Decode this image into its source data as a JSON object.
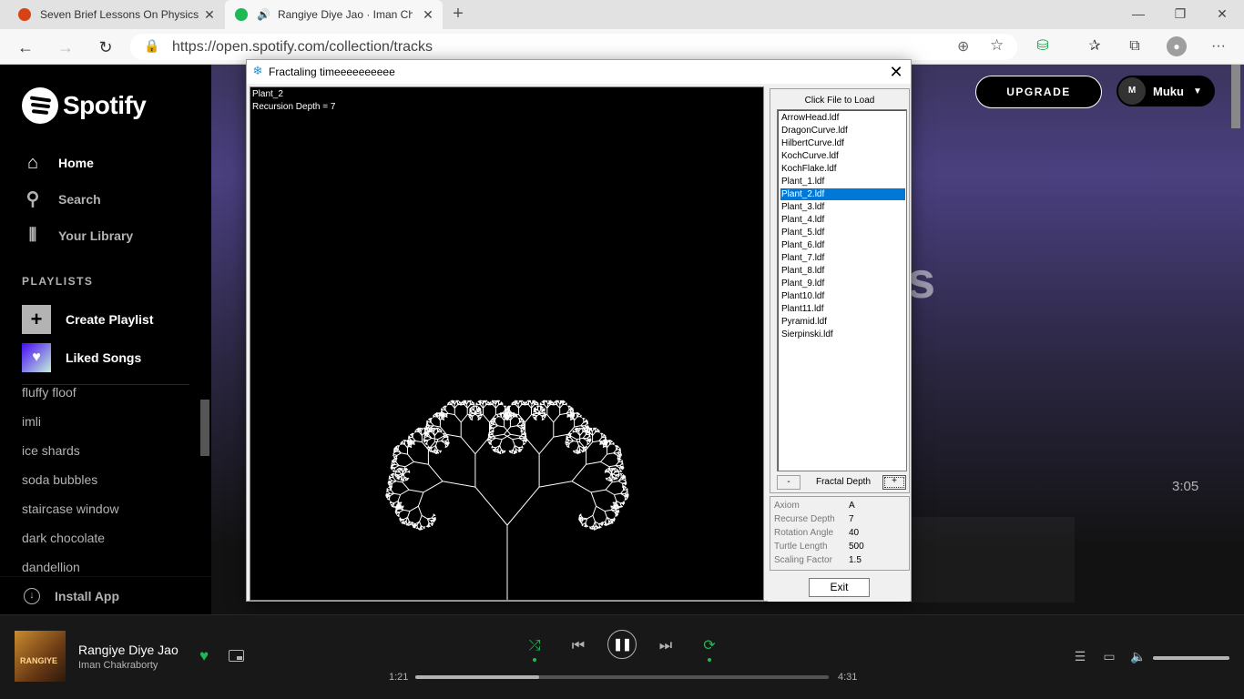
{
  "browser": {
    "tabs": [
      {
        "title": "Seven Brief Lessons On Physics -",
        "favicon_color": "#d84315"
      },
      {
        "title": "Rangiye Diye Jao · Iman Cha",
        "favicon_color": "#1db954"
      }
    ],
    "new_tab_icon": "plus-icon",
    "url": "https://open.spotify.com/collection/tracks",
    "icons": [
      "back-icon",
      "forward-icon",
      "refresh-icon",
      "lock-icon",
      "add-icon",
      "star-icon",
      "extension-icon",
      "favorites-icon",
      "collections-icon",
      "profile-icon",
      "more-icon"
    ]
  },
  "spotify": {
    "logo_text": "Spotify",
    "nav": [
      {
        "label": "Home",
        "icon": "home-icon"
      },
      {
        "label": "Search",
        "icon": "search-icon"
      },
      {
        "label": "Your Library",
        "icon": "library-icon"
      }
    ],
    "playlists_header": "PLAYLISTS",
    "create_playlist": "Create Playlist",
    "liked_songs": "Liked Songs",
    "playlists": [
      "fluffy floof",
      "imli",
      "ice shards",
      "soda bubbles",
      "staircase window",
      "dark chocolate",
      "dandellion"
    ],
    "install_app": "Install App",
    "upgrade": "UPGRADE",
    "avatar_text": "M",
    "user_name": "Muku",
    "background_letter": "s",
    "track_duration": "3:05",
    "accent": "#1db954"
  },
  "fractal_window": {
    "title": "Fractaling timeeeeeeeeee",
    "canvas_name": "Plant_2",
    "canvas_depth_text": "Recursion Depth = 7",
    "click_to_load": "Click File to Load",
    "files": [
      "ArrowHead.ldf",
      "DragonCurve.ldf",
      "HilbertCurve.ldf",
      "KochCurve.ldf",
      "KochFlake.ldf",
      "Plant_1.ldf",
      "Plant_2.ldf",
      "Plant_3.ldf",
      "Plant_4.ldf",
      "Plant_5.ldf",
      "Plant_6.ldf",
      "Plant_7.ldf",
      "Plant_8.ldf",
      "Plant_9.ldf",
      "Plant10.ldf",
      "Plant11.ldf",
      "Pyramid.ldf",
      "Sierpinski.ldf"
    ],
    "selected_file": "Plant_2.ldf",
    "minus_label": "-",
    "plus_label": "+",
    "depth_label": "Fractal Depth",
    "params": [
      {
        "label": "Axiom",
        "value": "A"
      },
      {
        "label": "Recurse Depth",
        "value": "7"
      },
      {
        "label": "Rotation Angle",
        "value": "40"
      },
      {
        "label": "Turtle Length",
        "value": "500"
      },
      {
        "label": "Scaling Factor",
        "value": "1.5"
      }
    ],
    "exit_label": "Exit"
  },
  "player": {
    "cover_text": "RANGIYE",
    "song_title": "Rangiye Diye Jao",
    "artist": "Iman Chakraborty",
    "elapsed": "1:21",
    "total": "4:31",
    "progress_fraction": 0.299,
    "volume_fraction": 1.0,
    "controls": [
      "shuffle-icon",
      "previous-icon",
      "pause-icon",
      "next-icon",
      "repeat-icon"
    ]
  }
}
